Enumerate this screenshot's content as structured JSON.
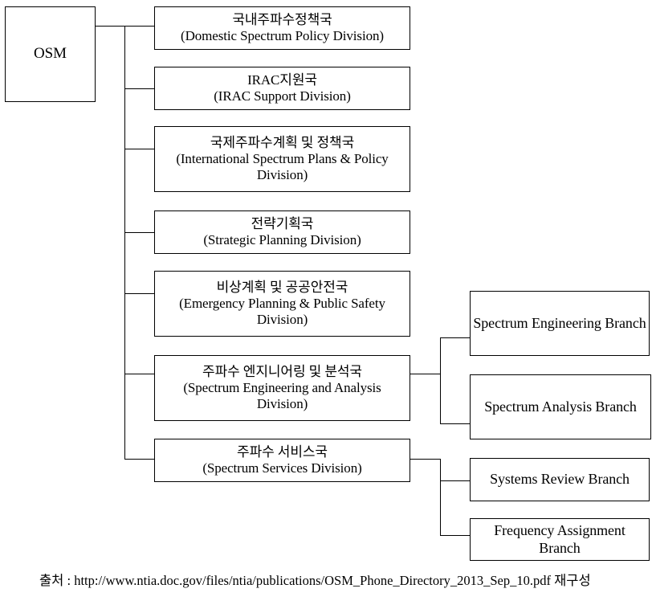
{
  "diagram": {
    "title_root": "OSM",
    "root": {
      "label": "OSM"
    },
    "divisions": [
      {
        "ko": "국내주파수정책국",
        "en": "(Domestic Spectrum Policy Division)"
      },
      {
        "ko": "IRAC지원국",
        "en": "(IRAC Support Division)"
      },
      {
        "ko": "국제주파수계획 및 정책국",
        "en": "(International Spectrum Plans & Policy Division)"
      },
      {
        "ko": "전략기획국",
        "en": "(Strategic Planning Division)"
      },
      {
        "ko": "비상계획 및 공공안전국",
        "en": "(Emergency Planning & Public Safety Division)"
      },
      {
        "ko": "주파수 엔지니어링 및 분석국",
        "en": "(Spectrum Engineering and Analysis Division)"
      },
      {
        "ko": "주파수 서비스국",
        "en": "(Spectrum Services Division)"
      }
    ],
    "branches": [
      {
        "label": "Spectrum Engineering Branch"
      },
      {
        "label": "Spectrum Analysis Branch"
      },
      {
        "label": "Systems Review Branch"
      },
      {
        "label": "Frequency Assignment Branch"
      }
    ]
  },
  "footer": {
    "text": "출처 : http://www.ntia.doc.gov/files/ntia/publications/OSM_Phone_Directory_2013_Sep_10.pdf 재구성"
  },
  "colors": {
    "stroke": "#000000",
    "background": "#ffffff",
    "text": "#000000"
  }
}
